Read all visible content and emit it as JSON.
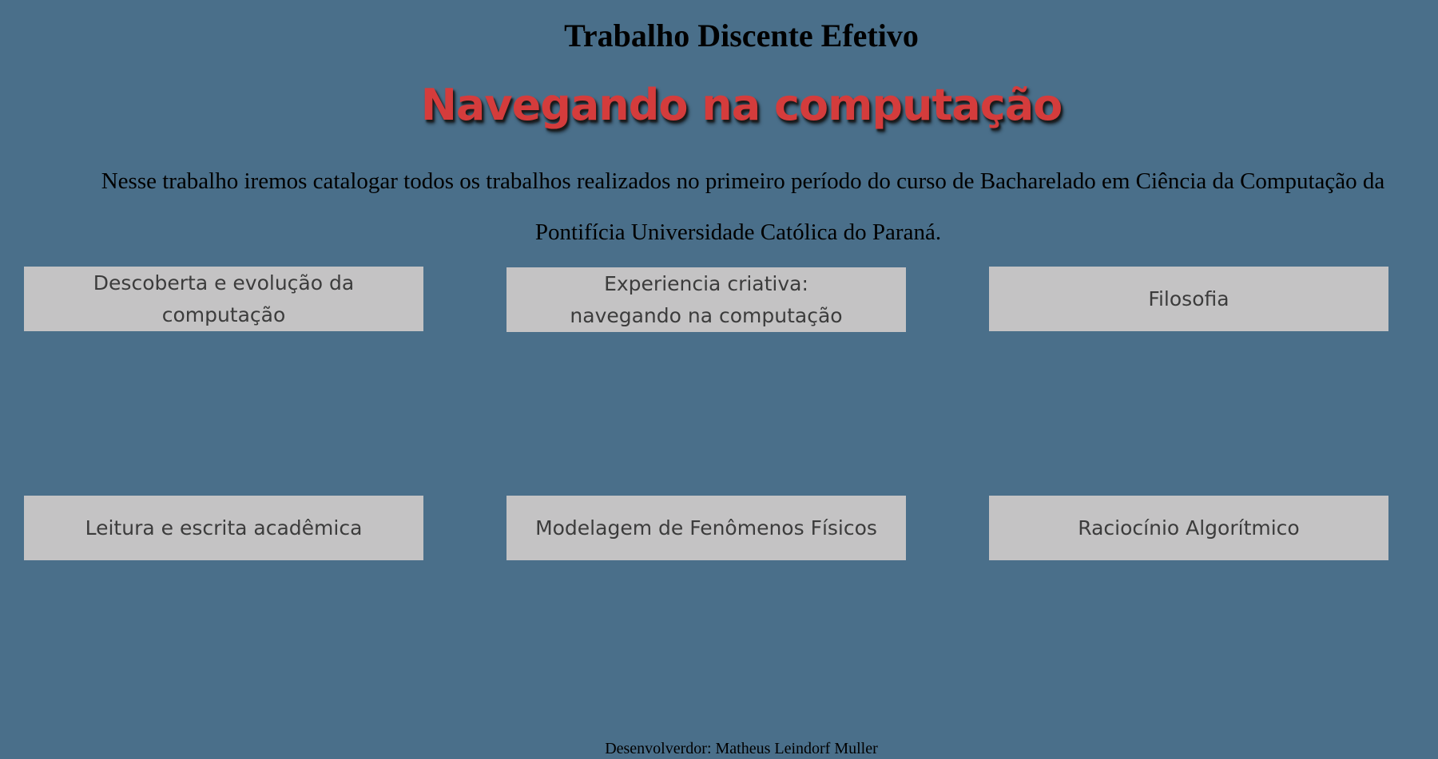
{
  "header": {
    "title": "Trabalho Discente Efetivo",
    "headline": "Navegando na computação"
  },
  "intro": {
    "text": "Nesse trabalho iremos catalogar todos os trabalhos realizados no primeiro período do curso de Bacharelado em Ciência da Computação da Pontifícia Universidade Católica do Paraná."
  },
  "cards": [
    {
      "label": "Descoberta e evolução da computação"
    },
    {
      "label_line1": "Experiencia criativa:",
      "label_line2": "navegando na computação"
    },
    {
      "label": "Filosofia"
    },
    {
      "label": "Leitura e escrita acadêmica"
    },
    {
      "label": "Modelagem de Fenômenos Físicos"
    },
    {
      "label": "Raciocínio Algorítmico"
    }
  ],
  "footer": {
    "text": "Desenvolverdor: Matheus Leindorf Muller"
  },
  "colors": {
    "background": "#4a6f8a",
    "card": "#c4c3c4",
    "headline": "#d43c3c"
  }
}
